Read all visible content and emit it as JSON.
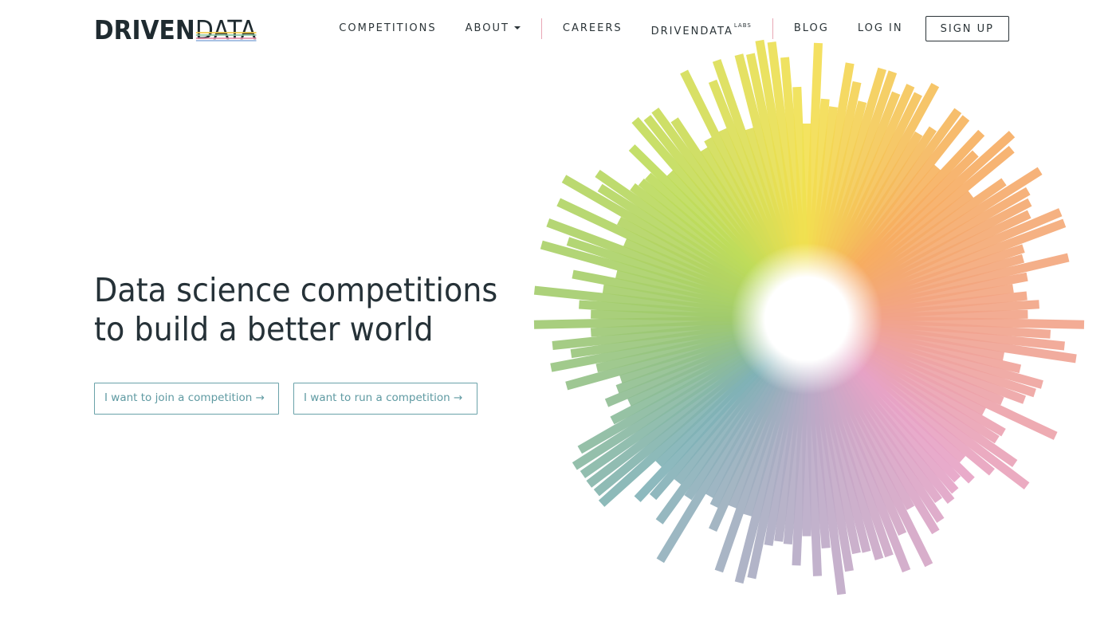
{
  "logo": {
    "part_bold": "DRIVEN",
    "part_light": "DATA",
    "stripe_colors": [
      "#f1c94b",
      "#8dc6a0",
      "#e88da8",
      "#9ab8e0"
    ]
  },
  "nav": {
    "competitions": "COMPETITIONS",
    "about": "ABOUT",
    "careers": "CAREERS",
    "drivendata_labs": "DRIVENDATA",
    "labs_superscript": "LABS",
    "blog": "BLOG",
    "login": "LOG IN",
    "signup": "SIGN UP"
  },
  "hero": {
    "headline_line1": "Data science competitions",
    "headline_line2": "to build a better world",
    "cta_join": "I want to join a competition →",
    "cta_run": "I want to run a competition →"
  },
  "colors": {
    "text_dark": "#263238",
    "accent_teal": "#5f9aa2",
    "nav_separator": "#e8a7b5",
    "gradient_stops": [
      "#f3e04f",
      "#f6ad5f",
      "#f2a388",
      "#e7a2c5",
      "#b9aac6",
      "#7fb1b6",
      "#9fca6e",
      "#bedb5a",
      "#f3e04f"
    ]
  }
}
